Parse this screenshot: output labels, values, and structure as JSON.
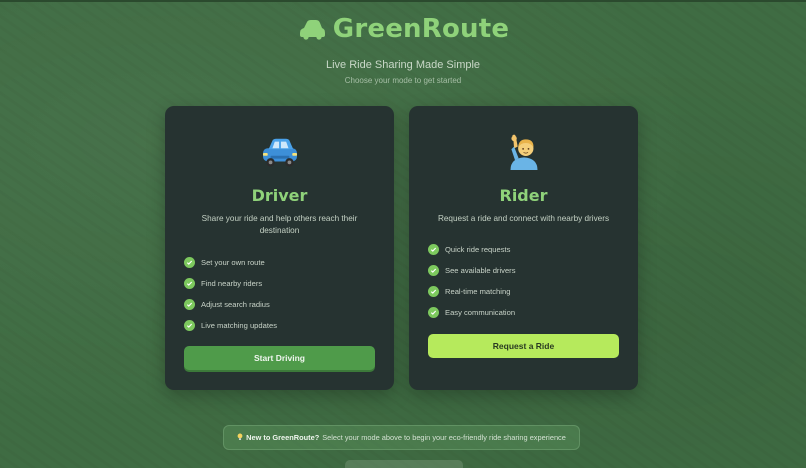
{
  "app": {
    "name": "GreenRoute",
    "tagline": "Live Ride Sharing Made Simple",
    "subtitle": "Choose your mode to get started"
  },
  "colors": {
    "brand": "#8fd27a",
    "background": "#3f6c43",
    "card": "#263331",
    "driver_button": "#4f9b4a",
    "rider_button": "#b6ea5c"
  },
  "cards": {
    "driver": {
      "icon": "car-icon",
      "title": "Driver",
      "description": "Share your ride and help others reach their destination",
      "features": [
        "Set your own route",
        "Find nearby riders",
        "Adjust search radius",
        "Live matching updates"
      ],
      "button_label": "Start Driving"
    },
    "rider": {
      "icon": "raising-hand-person-icon",
      "title": "Rider",
      "description": "Request a ride and connect with nearby drivers",
      "features": [
        "Quick ride requests",
        "See available drivers",
        "Real-time matching",
        "Easy communication"
      ],
      "button_label": "Request a Ride"
    }
  },
  "tip": {
    "icon": "lightbulb-icon",
    "bold": "New to GreenRoute?",
    "text": "Select your mode above to begin your eco-friendly ride sharing experience"
  }
}
